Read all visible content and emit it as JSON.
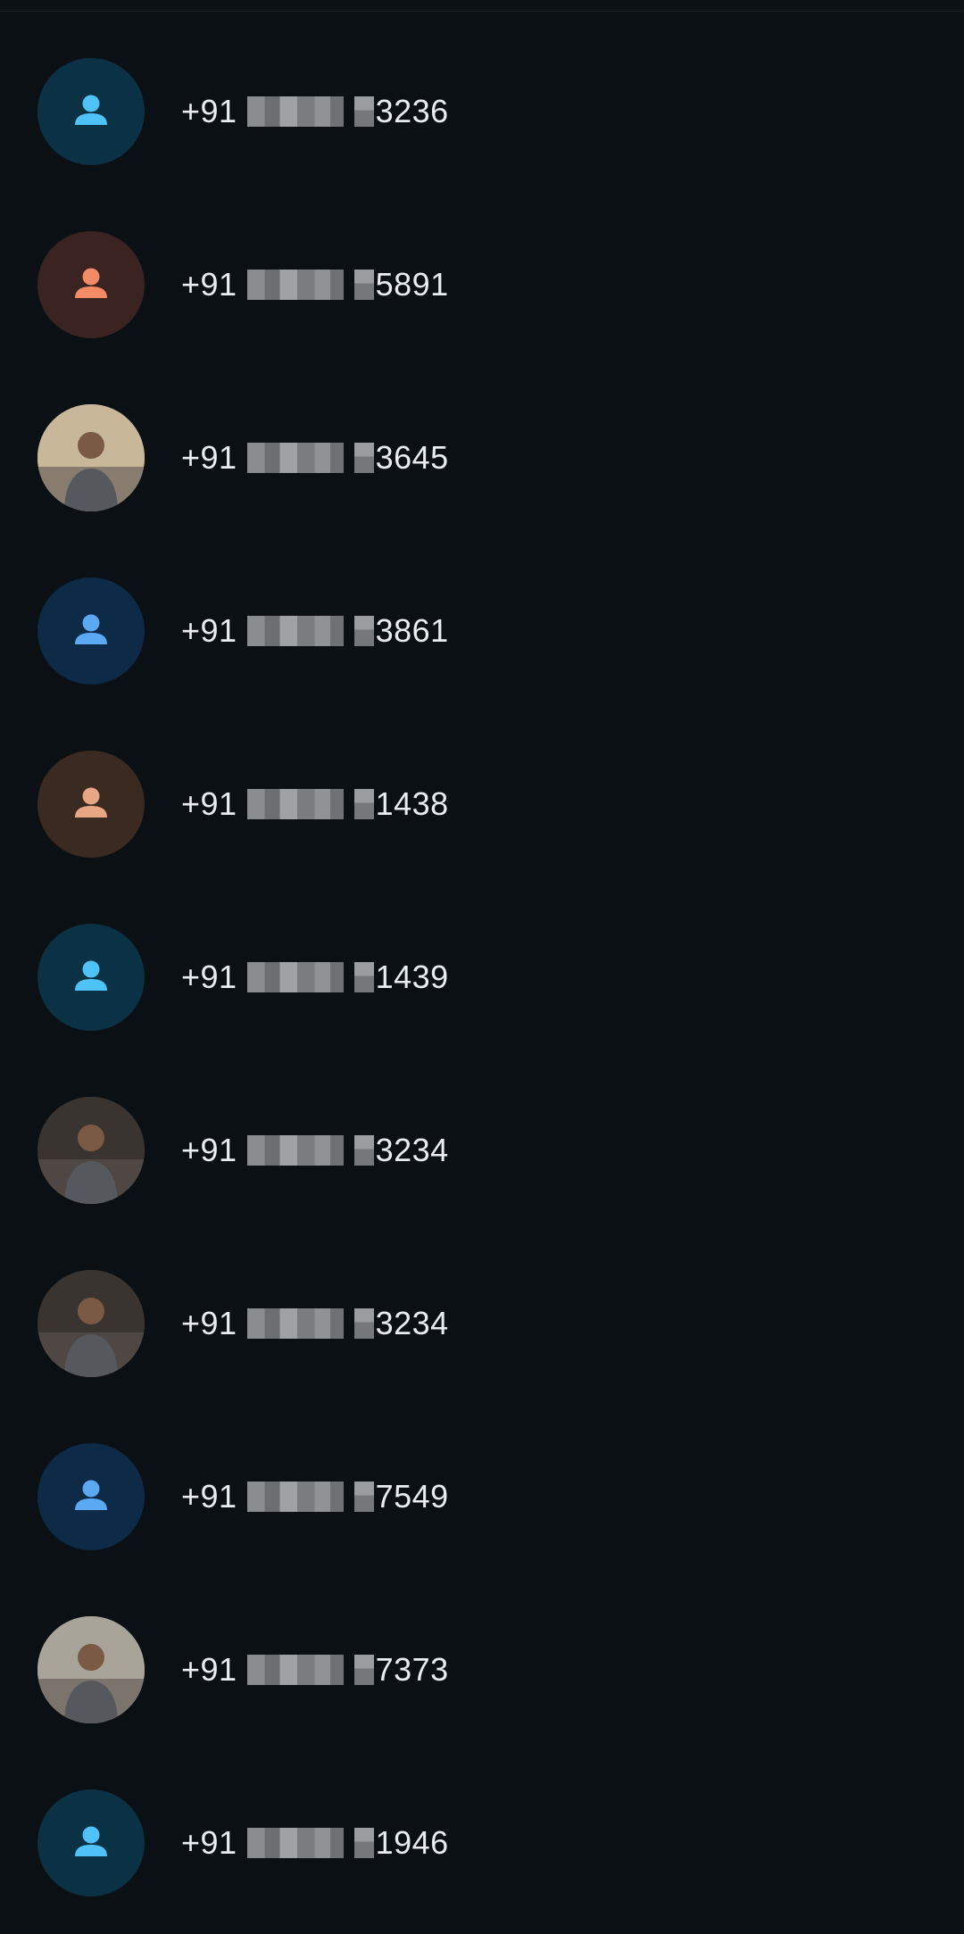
{
  "contacts": [
    {
      "prefix": "+91",
      "suffix": "3236",
      "avatar": "person-icon",
      "bg": "#0b3145",
      "fg": "#4fc3f7"
    },
    {
      "prefix": "+91",
      "suffix": "5891",
      "avatar": "person-icon",
      "bg": "#3a2320",
      "fg": "#f28b66"
    },
    {
      "prefix": "+91",
      "suffix": "3645",
      "avatar": "profile-photo",
      "bg": "#c9b79a",
      "fg": "#ffffff"
    },
    {
      "prefix": "+91",
      "suffix": "3861",
      "avatar": "person-icon",
      "bg": "#0d2a47",
      "fg": "#5aa9f2"
    },
    {
      "prefix": "+91",
      "suffix": "1438",
      "avatar": "person-icon",
      "bg": "#3a2a22",
      "fg": "#e8a784"
    },
    {
      "prefix": "+91",
      "suffix": "1439",
      "avatar": "person-icon",
      "bg": "#0b3145",
      "fg": "#4fc3f7"
    },
    {
      "prefix": "+91",
      "suffix": "3234",
      "avatar": "profile-photo",
      "bg": "#3a3430",
      "fg": "#ffffff"
    },
    {
      "prefix": "+91",
      "suffix": "3234",
      "avatar": "profile-photo",
      "bg": "#3a3430",
      "fg": "#ffffff"
    },
    {
      "prefix": "+91",
      "suffix": "7549",
      "avatar": "person-icon",
      "bg": "#0d2a47",
      "fg": "#5aa9f2"
    },
    {
      "prefix": "+91",
      "suffix": "7373",
      "avatar": "profile-photo",
      "bg": "#a9a49a",
      "fg": "#ffffff"
    },
    {
      "prefix": "+91",
      "suffix": "1946",
      "avatar": "person-icon",
      "bg": "#0b3145",
      "fg": "#4fc3f7"
    }
  ]
}
